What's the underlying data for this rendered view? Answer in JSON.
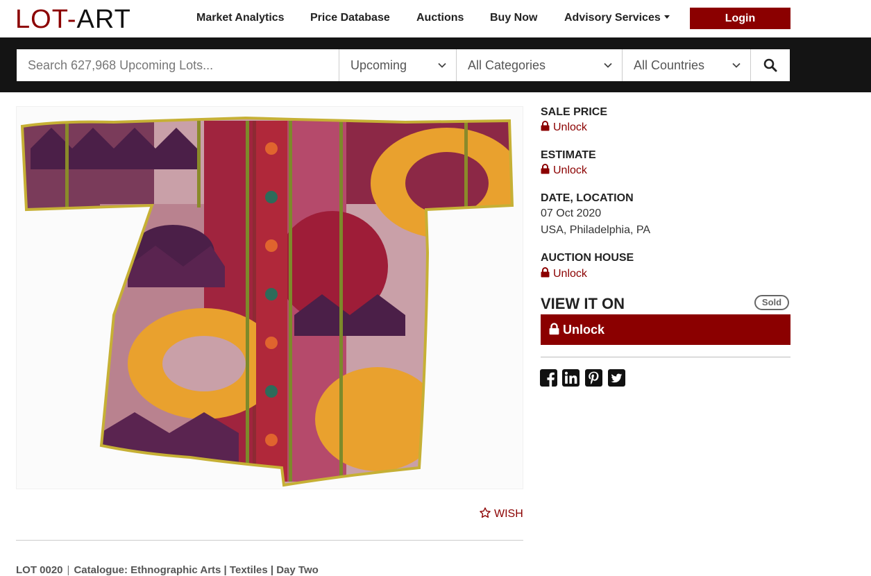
{
  "header": {
    "logo": {
      "part1": "LOT",
      "dash": "-",
      "part2": "ART"
    },
    "nav": [
      {
        "label": "Market Analytics"
      },
      {
        "label": "Price Database"
      },
      {
        "label": "Auctions"
      },
      {
        "label": "Buy Now"
      },
      {
        "label": "Advisory Services"
      }
    ],
    "login_label": "Login"
  },
  "search": {
    "placeholder": "Search 627,968 Upcoming Lots...",
    "status_select": "Upcoming",
    "category_select": "All Categories",
    "country_select": "All Countries"
  },
  "lot": {
    "image_alt": "Ikat silk robe (chapan)",
    "wish_label": "WISH",
    "lot_number": "LOT 0020",
    "catalogue": "Catalogue: Ethnographic Arts | Textiles | Day Two"
  },
  "details": {
    "sale_price_label": "SALE PRICE",
    "estimate_label": "ESTIMATE",
    "date_location_label": "DATE, LOCATION",
    "date": "07 Oct 2020",
    "location": "USA, Philadelphia, PA",
    "auction_house_label": "AUCTION HOUSE",
    "unlock_label": "Unlock",
    "view_it_on_label": "VIEW IT ON",
    "status_badge": "Sold"
  },
  "colors": {
    "brand": "#8b0000",
    "band": "#141414"
  },
  "icons": [
    "lock-icon",
    "search-icon",
    "chevron-down-icon",
    "star-icon",
    "facebook-icon",
    "linkedin-icon",
    "pinterest-icon",
    "twitter-icon"
  ]
}
